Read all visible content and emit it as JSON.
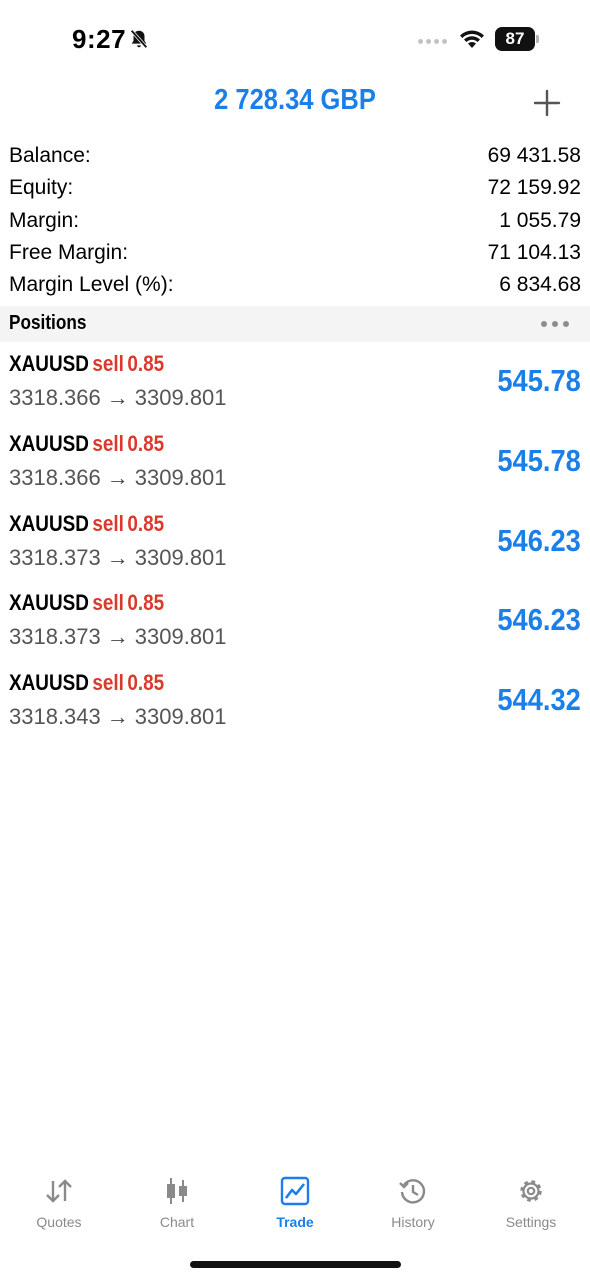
{
  "status_bar": {
    "time": "9:27",
    "battery": "87"
  },
  "header": {
    "title": "2 728.34 GBP"
  },
  "account": {
    "rows": [
      {
        "label": "Balance:",
        "value": "69 431.58"
      },
      {
        "label": "Equity:",
        "value": "72 159.92"
      },
      {
        "label": "Margin:",
        "value": "1 055.79"
      },
      {
        "label": "Free Margin:",
        "value": "71 104.13"
      },
      {
        "label": "Margin Level (%):",
        "value": "6 834.68"
      }
    ]
  },
  "positions": {
    "title": "Positions",
    "items": [
      {
        "symbol": "XAUUSD",
        "side": "sell",
        "volume": "0.85",
        "open_price": "3318.366",
        "arrow": "→",
        "current_price": "3309.801",
        "profit": "545.78"
      },
      {
        "symbol": "XAUUSD",
        "side": "sell",
        "volume": "0.85",
        "open_price": "3318.366",
        "arrow": "→",
        "current_price": "3309.801",
        "profit": "545.78"
      },
      {
        "symbol": "XAUUSD",
        "side": "sell",
        "volume": "0.85",
        "open_price": "3318.373",
        "arrow": "→",
        "current_price": "3309.801",
        "profit": "546.23"
      },
      {
        "symbol": "XAUUSD",
        "side": "sell",
        "volume": "0.85",
        "open_price": "3318.373",
        "arrow": "→",
        "current_price": "3309.801",
        "profit": "546.23"
      },
      {
        "symbol": "XAUUSD",
        "side": "sell",
        "volume": "0.85",
        "open_price": "3318.343",
        "arrow": "→",
        "current_price": "3309.801",
        "profit": "544.32"
      }
    ]
  },
  "tabs": [
    {
      "label": "Quotes",
      "icon": "quotes-arrows-icon",
      "active": false
    },
    {
      "label": "Chart",
      "icon": "candlestick-chart-icon",
      "active": false
    },
    {
      "label": "Trade",
      "icon": "trade-chart-icon",
      "active": true
    },
    {
      "label": "History",
      "icon": "history-clock-icon",
      "active": false
    },
    {
      "label": "Settings",
      "icon": "gear-icon",
      "active": false
    }
  ],
  "colors": {
    "accent": "#1a7fe8",
    "sell": "#d93a2b",
    "tab_inactive": "#8a8a8a"
  }
}
